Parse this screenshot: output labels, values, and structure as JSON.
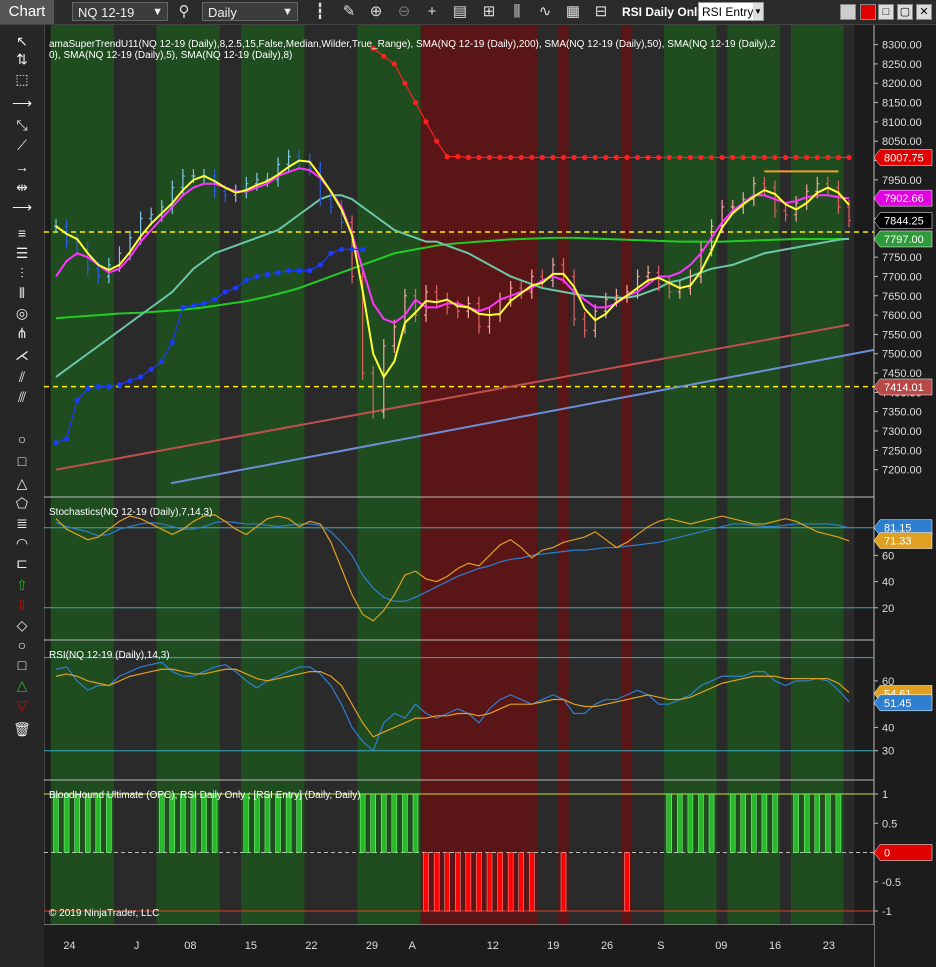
{
  "toolbar": {
    "tab": "Chart",
    "instrument": "NQ 12-19",
    "period": "Daily",
    "strategy_label": "RSI Daily Only",
    "strategy_value": "RSI Entry"
  },
  "panels": {
    "price": {
      "indicator_label": "amaSuperTrendU11(NQ 12-19 (Daily),8,2.5,15,False,Median,Wilder,True_Range), SMA(NQ 12-19 (Daily),200), SMA(NQ 12-19 (Daily),50), SMA(NQ 12-19 (Daily),20), SMA(NQ 12-19 (Daily),5), SMA(NQ 12-19 (Daily),8)",
      "axis_ticks": [
        "8300.00",
        "8250.00",
        "8200.00",
        "8150.00",
        "8100.00",
        "8050.00",
        "8000.00",
        "7950.00",
        "7900.00",
        "7850.00",
        "7800.00",
        "7750.00",
        "7700.00",
        "7650.00",
        "7600.00",
        "7550.00",
        "7500.00",
        "7450.00",
        "7400.00",
        "7350.00",
        "7300.00",
        "7250.00",
        "7200.00"
      ],
      "markers": [
        {
          "text": "8007.75",
          "color": "#e00000"
        },
        {
          "text": "7902.66",
          "color": "#e000e0"
        },
        {
          "text": "7844.25",
          "color": "#000000"
        },
        {
          "text": "7797.00",
          "color": "#2e9a3a"
        },
        {
          "text": "7414.01",
          "color": "#b84848"
        }
      ]
    },
    "stochastics": {
      "label": "Stochastics(NQ 12-19 (Daily),7,14,3)",
      "axis_ticks": [
        "60",
        "40",
        "20"
      ],
      "markers": [
        {
          "text": "81.15",
          "color": "#2f7fd0"
        },
        {
          "text": "71.33",
          "color": "#e0a020"
        }
      ]
    },
    "rsi": {
      "label": "RSI(NQ 12-19 (Daily),14,3)",
      "axis_ticks": [
        "60",
        "50",
        "40",
        "30"
      ],
      "markers": [
        {
          "text": "54.61",
          "color": "#e0a020"
        },
        {
          "text": "51.45",
          "color": "#2f7fd0"
        }
      ]
    },
    "bloodhound": {
      "label": "BloodHound Ultimate (OPC), RSI Daily Only ; [RSI Entry] (Daily, Daily)",
      "axis_ticks": [
        "1",
        "0.5",
        "-0.5",
        "-1"
      ],
      "marker": {
        "text": "0",
        "color": "#e00000"
      },
      "copyright": "© 2019 NinjaTrader, LLC"
    }
  },
  "time_axis": [
    "24",
    "J",
    "08",
    "15",
    "22",
    "29",
    "A",
    "12",
    "19",
    "26",
    "S",
    "09",
    "16",
    "23"
  ],
  "colors": {
    "bull_zone": "#1f4d1f",
    "bear_zone": "#5a1616",
    "bull_bar": "#29b829",
    "bear_bar": "#ff0000"
  },
  "chart_data": [
    {
      "type": "candlestick",
      "instrument": "NQ 12-19",
      "ylim": [
        7150,
        8330
      ],
      "levels": {
        "current": 7844.25,
        "supertrend": 8007.75,
        "sma5": 7902.66,
        "sma50": 7797.0,
        "sma200": 7414.01,
        "dashed_upper": 7815,
        "dashed_lower": 7415
      },
      "close": [
        7830,
        7790,
        7770,
        7720,
        7700,
        7730,
        7760,
        7800,
        7850,
        7860,
        7880,
        7930,
        7960,
        7960,
        7960,
        7920,
        7910,
        7920,
        7940,
        7950,
        7950,
        7990,
        8010,
        8000,
        7980,
        7900,
        7880,
        7840,
        7700,
        7450,
        7350,
        7520,
        7570,
        7650,
        7600,
        7660,
        7640,
        7620,
        7610,
        7630,
        7570,
        7600,
        7640,
        7670,
        7660,
        7700,
        7690,
        7730,
        7700,
        7590,
        7560,
        7610,
        7640,
        7650,
        7660,
        7700,
        7710,
        7680,
        7660,
        7670,
        7700,
        7770,
        7830,
        7880,
        7880,
        7900,
        7940,
        7930,
        7870,
        7860,
        7890,
        7920,
        7940,
        7930,
        7880,
        7845
      ],
      "sma5": [
        7700,
        7740,
        7760,
        7750,
        7730,
        7710,
        7720,
        7750,
        7790,
        7820,
        7850,
        7880,
        7910,
        7930,
        7940,
        7940,
        7930,
        7920,
        7920,
        7930,
        7940,
        7960,
        7970,
        7980,
        7975,
        7955,
        7920,
        7880,
        7810,
        7720,
        7630,
        7590,
        7580,
        7600,
        7640,
        7620,
        7620,
        7630,
        7630,
        7620,
        7610,
        7620,
        7640,
        7650,
        7660,
        7670,
        7690,
        7700,
        7690,
        7660,
        7640,
        7620,
        7620,
        7630,
        7650,
        7660,
        7680,
        7700,
        7700,
        7710,
        7730,
        7760,
        7800,
        7840,
        7870,
        7890,
        7910,
        7910,
        7900,
        7890,
        7895,
        7905,
        7910,
        7910,
        7905,
        7902
      ],
      "sma20": [
        7440,
        7460,
        7480,
        7500,
        7520,
        7540,
        7560,
        7580,
        7600,
        7620,
        7640,
        7660,
        7690,
        7720,
        7740,
        7760,
        7770,
        7780,
        7790,
        7800,
        7810,
        7820,
        7840,
        7860,
        7880,
        7900,
        7910,
        7910,
        7900,
        7880,
        7860,
        7840,
        7820,
        7810,
        7800,
        7790,
        7790,
        7780,
        7770,
        7760,
        7745,
        7730,
        7715,
        7700,
        7690,
        7680,
        7670,
        7665,
        7660,
        7655,
        7650,
        7648,
        7646,
        7645,
        7645,
        7650,
        7660,
        7670,
        7685,
        7690,
        7700,
        7710,
        7720,
        7725,
        7730,
        7740,
        7750,
        7760,
        7765,
        7770,
        7775,
        7780,
        7785,
        7790,
        7795,
        7798
      ],
      "sma50": [
        7592,
        7594,
        7596,
        7598,
        7600,
        7602,
        7604,
        7605,
        7606,
        7608,
        7610,
        7612,
        7614,
        7617,
        7620,
        7624,
        7628,
        7632,
        7636,
        7642,
        7648,
        7655,
        7662,
        7670,
        7680,
        7690,
        7700,
        7710,
        7720,
        7730,
        7740,
        7750,
        7760,
        7765,
        7770,
        7775,
        7780,
        7783,
        7786,
        7788,
        7790,
        7792,
        7794,
        7796,
        7797,
        7798,
        7799,
        7800,
        7800,
        7800,
        7799,
        7798,
        7797,
        7796,
        7795,
        7794,
        7793,
        7792,
        7791,
        7790,
        7790,
        7790,
        7790,
        7790,
        7791,
        7792,
        7793,
        7794,
        7795,
        7796,
        7797,
        7797,
        7797,
        7797,
        7797,
        7797
      ],
      "sma200": [
        7200,
        7205,
        7210,
        7215,
        7220,
        7225,
        7230,
        7235,
        7240,
        7245,
        7250,
        7255,
        7260,
        7265,
        7270,
        7275,
        7280,
        7285,
        7290,
        7295,
        7300,
        7305,
        7310,
        7315,
        7320,
        7325,
        7330,
        7335,
        7340,
        7345,
        7350,
        7355,
        7360,
        7365,
        7370,
        7375,
        7380,
        7385,
        7390,
        7395,
        7400,
        7405,
        7410,
        7415,
        7420,
        7425,
        7430,
        7435,
        7440,
        7445,
        7450,
        7455,
        7460,
        7465,
        7470,
        7475,
        7480,
        7485,
        7490,
        7495,
        7500,
        7505,
        7510,
        7515,
        7520,
        7525,
        7530,
        7535,
        7540,
        7545,
        7550,
        7555,
        7560,
        7565,
        7570,
        7575
      ],
      "supertrend": [
        7270,
        7280,
        7380,
        7410,
        7415,
        7415,
        7420,
        7430,
        7440,
        7460,
        7480,
        7530,
        7620,
        7625,
        7630,
        7640,
        7660,
        7670,
        7690,
        7700,
        7705,
        7710,
        7715,
        7715,
        7715,
        7730,
        7760,
        7770,
        7770,
        7770,
        8290,
        8270,
        8250,
        8200,
        8150,
        8100,
        8050,
        8010,
        8010,
        8008,
        8008,
        8008,
        8008,
        8008,
        8008,
        8008,
        8008,
        8008,
        8008,
        8008,
        8008,
        8008,
        8008,
        8008,
        8008,
        8008,
        8008,
        8008,
        8008,
        8008,
        8008,
        8008,
        8008,
        8008,
        8008,
        8008,
        8008,
        8008,
        8008,
        8008,
        8008,
        8008,
        8008,
        8008,
        8008,
        8008
      ]
    },
    {
      "type": "line",
      "name": "Stochastics",
      "ylim": [
        0,
        100
      ],
      "series": [
        {
          "name": "D",
          "values": [
            85,
            82,
            80,
            78,
            75,
            76,
            80,
            82,
            84,
            85,
            84,
            82,
            80,
            80,
            82,
            85,
            86,
            85,
            84,
            84,
            83,
            82,
            83,
            84,
            84,
            83,
            78,
            70,
            60,
            45,
            35,
            28,
            25,
            25,
            28,
            32,
            36,
            40,
            44,
            47,
            50,
            52,
            55,
            57,
            58,
            60,
            61,
            62,
            63,
            64,
            64,
            65,
            66,
            66,
            67,
            68,
            69,
            70,
            72,
            74,
            76,
            78,
            80,
            82,
            84,
            84,
            83,
            82,
            82,
            83,
            84,
            84,
            84,
            84,
            83,
            81
          ]
        },
        {
          "name": "K",
          "values": [
            88,
            80,
            76,
            72,
            74,
            80,
            86,
            90,
            88,
            84,
            80,
            76,
            80,
            86,
            90,
            91,
            86,
            80,
            76,
            82,
            88,
            90,
            88,
            82,
            86,
            84,
            70,
            50,
            30,
            15,
            10,
            18,
            30,
            45,
            48,
            42,
            40,
            44,
            50,
            54,
            52,
            60,
            68,
            72,
            66,
            58,
            64,
            66,
            70,
            72,
            74,
            78,
            72,
            66,
            70,
            76,
            82,
            86,
            88,
            86,
            84,
            86,
            88,
            90,
            88,
            86,
            84,
            84,
            86,
            88,
            86,
            82,
            78,
            76,
            74,
            71
          ]
        }
      ]
    },
    {
      "type": "line",
      "name": "RSI",
      "ylim": [
        20,
        75
      ],
      "series": [
        {
          "name": "RSI",
          "values": [
            65,
            66,
            60,
            56,
            58,
            58,
            62,
            64,
            66,
            67,
            68,
            64,
            62,
            62,
            64,
            66,
            67,
            64,
            60,
            57,
            60,
            62,
            64,
            66,
            66,
            63,
            58,
            50,
            40,
            34,
            30,
            42,
            46,
            44,
            50,
            46,
            44,
            46,
            48,
            46,
            42,
            48,
            52,
            54,
            52,
            50,
            52,
            54,
            52,
            46,
            46,
            50,
            52,
            52,
            54,
            56,
            54,
            50,
            50,
            52,
            54,
            58,
            60,
            62,
            62,
            62,
            64,
            64,
            60,
            58,
            60,
            60,
            61,
            60,
            56,
            51
          ]
        },
        {
          "name": "Signal",
          "values": [
            62,
            63,
            62,
            60,
            59,
            58,
            60,
            62,
            63,
            64,
            65,
            65,
            64,
            63,
            63,
            64,
            65,
            65,
            63,
            61,
            60,
            61,
            62,
            63,
            64,
            64,
            62,
            58,
            50,
            42,
            36,
            38,
            40,
            42,
            44,
            44,
            45,
            45,
            46,
            46,
            45,
            46,
            48,
            50,
            50,
            50,
            51,
            52,
            52,
            50,
            49,
            49,
            50,
            51,
            52,
            53,
            54,
            53,
            52,
            52,
            53,
            55,
            57,
            59,
            60,
            61,
            62,
            62,
            62,
            61,
            61,
            61,
            61,
            61,
            59,
            55
          ]
        }
      ]
    },
    {
      "type": "bar",
      "name": "BloodHound Ultimate (OPC)",
      "ylim": [
        -1,
        1
      ],
      "values": [
        1,
        1,
        1,
        1,
        1,
        1,
        0,
        0,
        0,
        0,
        1,
        1,
        1,
        1,
        1,
        1,
        0,
        0,
        1,
        1,
        1,
        1,
        1,
        1,
        0,
        0,
        0,
        0,
        0,
        1,
        1,
        1,
        1,
        1,
        1,
        -1,
        -1,
        -1,
        -1,
        -1,
        -1,
        -1,
        -1,
        -1,
        -1,
        -1,
        0,
        0,
        -1,
        0,
        0,
        0,
        0,
        0,
        -1,
        0,
        0,
        0,
        1,
        1,
        1,
        1,
        1,
        0,
        1,
        1,
        1,
        1,
        1,
        0,
        1,
        1,
        1,
        1,
        1,
        0
      ]
    }
  ]
}
